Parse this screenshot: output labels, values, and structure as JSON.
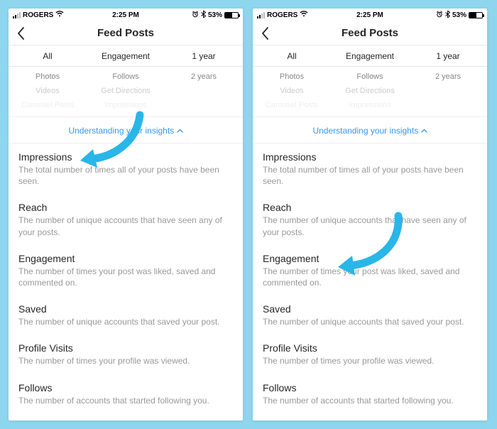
{
  "status": {
    "carrier": "ROGERS",
    "time": "2:25 PM",
    "battery_pct": "53%"
  },
  "header": {
    "title": "Feed Posts"
  },
  "filters": {
    "col1": "All",
    "col2": "Engagement",
    "col3": "1 year"
  },
  "picker": {
    "row1": {
      "c1": "Photos",
      "c2": "Follows",
      "c3": "2 years"
    },
    "row2": {
      "c1": "Videos",
      "c2": "Get Directions",
      "c3": ""
    },
    "row3": {
      "c1": "Carousel Posts",
      "c2": "Impressions",
      "c3": ""
    }
  },
  "understand_label": "Understanding your insights",
  "definitions": [
    {
      "term": "Impressions",
      "desc": "The total number of times all of your posts have been seen."
    },
    {
      "term": "Reach",
      "desc": "The number of unique accounts that have seen any of your posts."
    },
    {
      "term": "Engagement",
      "desc": "The number of times your post was liked, saved and commented on."
    },
    {
      "term": "Saved",
      "desc": "The number of unique accounts that saved your post."
    },
    {
      "term": "Profile Visits",
      "desc": "The number of times your profile was viewed."
    },
    {
      "term": "Follows",
      "desc": "The number of accounts that started following you."
    }
  ],
  "colors": {
    "background": "#8dd6ed",
    "link": "#3897f0",
    "arrow": "#29b6e8"
  },
  "arrows": {
    "left_target": "Impressions",
    "right_target": "Engagement"
  }
}
